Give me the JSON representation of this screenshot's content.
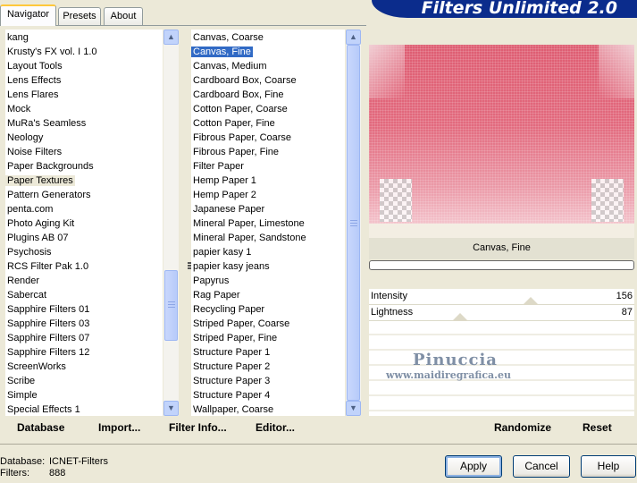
{
  "tabs": [
    {
      "label": "Navigator",
      "active": true
    },
    {
      "label": "Presets",
      "active": false
    },
    {
      "label": "About",
      "active": false
    }
  ],
  "banner": {
    "title": "Filters Unlimited 2.0"
  },
  "categories": {
    "selected": "Paper Textures",
    "items": [
      "kang",
      "Krusty's FX vol. I 1.0",
      "Layout Tools",
      "Lens Effects",
      "Lens Flares",
      "Mock",
      "MuRa's Seamless",
      "Neology",
      "Noise Filters",
      "Paper Backgrounds",
      "Paper Textures",
      "Pattern Generators",
      "penta.com",
      "Photo Aging Kit",
      "Plugins AB 07",
      "Psychosis",
      "RCS Filter Pak 1.0",
      "Render",
      "Sabercat",
      "Sapphire Filters 01",
      "Sapphire Filters 03",
      "Sapphire Filters 07",
      "Sapphire Filters 12",
      "ScreenWorks",
      "Scribe",
      "Simple",
      "Special Effects 1"
    ]
  },
  "filters": {
    "selected": "Canvas, Fine",
    "items": [
      "Canvas, Coarse",
      "Canvas, Fine",
      "Canvas, Medium",
      "Cardboard Box, Coarse",
      "Cardboard Box, Fine",
      "Cotton Paper, Coarse",
      "Cotton Paper, Fine",
      "Fibrous Paper, Coarse",
      "Fibrous Paper, Fine",
      "Filter Paper",
      "Hemp Paper 1",
      "Hemp Paper 2",
      "Japanese Paper",
      "Mineral Paper, Limestone",
      "Mineral Paper, Sandstone",
      "papier kasy 1",
      "papier kasy jeans",
      "Papyrus",
      "Rag Paper",
      "Recycling Paper",
      "Striped Paper, Coarse",
      "Striped Paper, Fine",
      "Structure Paper 1",
      "Structure Paper 2",
      "Structure Paper 3",
      "Structure Paper 4",
      "Wallpaper, Coarse"
    ]
  },
  "list_buttons": {
    "database": "Database",
    "import": "Import...",
    "filter_info": "Filter Info...",
    "editor": "Editor..."
  },
  "preview": {
    "filter_name": "Canvas, Fine",
    "colors": {
      "top": "#DE5D72",
      "bottom": "#F3C3CB"
    }
  },
  "sliders": [
    {
      "label": "Intensity",
      "value": "156",
      "fraction": 0.612
    },
    {
      "label": "Lightness",
      "value": "87",
      "fraction": 0.341
    }
  ],
  "watermark": {
    "name": "Pinuccia",
    "url": "www.maidiregrafica.eu"
  },
  "actions": {
    "randomize": "Randomize",
    "reset": "Reset"
  },
  "status": {
    "database_label": "Database:",
    "database_value": "ICNET-Filters",
    "filters_label": "Filters:",
    "filters_value": "888"
  },
  "dialog_buttons": {
    "apply": "Apply",
    "cancel": "Cancel",
    "help": "Help"
  }
}
